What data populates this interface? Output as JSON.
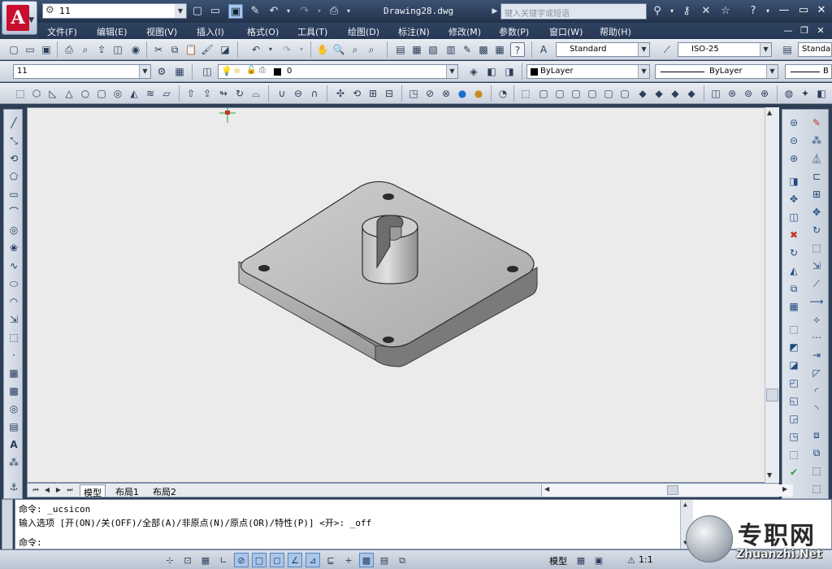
{
  "title_bar": {
    "workspace": "11",
    "filename": "Drawing28.dwg",
    "search_placeholder": "键入关键字或短语"
  },
  "menu": [
    "文件(F)",
    "编辑(E)",
    "视图(V)",
    "插入(I)",
    "格式(O)",
    "工具(T)",
    "绘图(D)",
    "标注(N)",
    "修改(M)",
    "参数(P)",
    "窗口(W)",
    "帮助(H)"
  ],
  "styles": {
    "text_style": "Standard",
    "dim_style": "ISO-25",
    "table_style": "Standa"
  },
  "layers": {
    "workspace_combo": "11",
    "current_layer": "0",
    "color": "ByLayer",
    "linetype": "ByLayer",
    "lineweight": "B"
  },
  "tabs": [
    "模型",
    "布局1",
    "布局2"
  ],
  "command": {
    "line1": "命令:  _ucsicon",
    "line2": "输入选项 [开(ON)/关(OFF)/全部(A)/非原点(N)/原点(OR)/特性(P)] <开>: _off",
    "prompt": "命令:"
  },
  "status": {
    "model_label": "模型",
    "scale": "1:1"
  },
  "watermark": {
    "cn": "专职网",
    "en": "Zhuanzhi.Net"
  },
  "colors": {
    "accent": "#c8102e",
    "chrome": "#2d3e55",
    "canvas": "#ebebeb"
  }
}
